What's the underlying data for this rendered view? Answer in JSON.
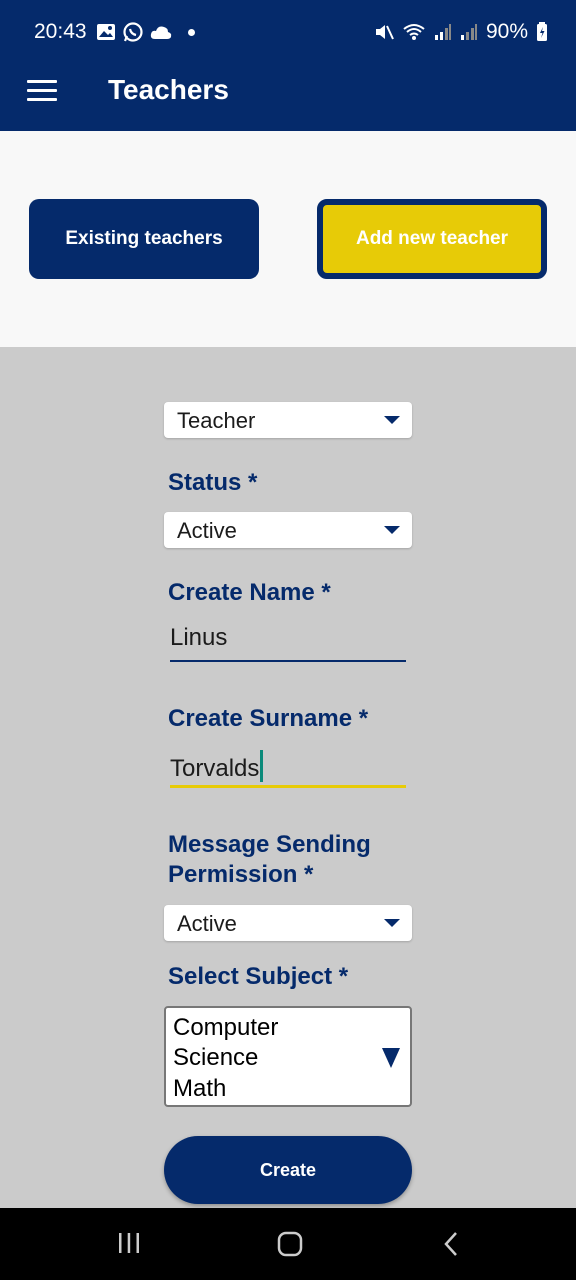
{
  "status_bar": {
    "time": "20:43",
    "battery": "90%",
    "left_icons": [
      "image-icon",
      "whatsapp-icon",
      "cloud-icon",
      "dot-icon"
    ],
    "right_icons": [
      "mute-icon",
      "wifi-icon",
      "signal-icon",
      "signal-icon",
      "battery-icon"
    ]
  },
  "app_bar": {
    "title": "Teachers"
  },
  "tabs": {
    "existing": "Existing teachers",
    "add_new": "Add new teacher"
  },
  "form": {
    "role_select": "Teacher",
    "status_label": "Status *",
    "status_value": "Active",
    "name_label": "Create Name *",
    "name_value": "Linus",
    "surname_label": "Create Surname *",
    "surname_value": "Torvalds",
    "permission_label": "Message Sending Permission *",
    "permission_value": "Active",
    "subject_label": "Select Subject *",
    "subject_options": [
      "Computer",
      "Science",
      "Math"
    ],
    "create_button": "Create"
  },
  "colors": {
    "primary": "#052a6b",
    "accent": "#e7cb07",
    "form_background": "#cbcbcb"
  }
}
